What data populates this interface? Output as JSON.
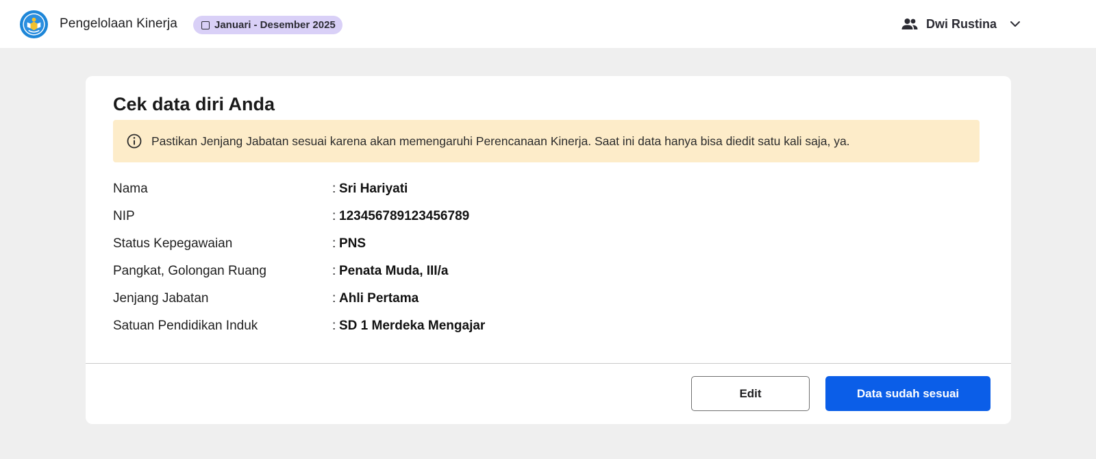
{
  "header": {
    "app_title": "Pengelolaan Kinerja",
    "period_badge": "Januari - Desember 2025",
    "user_name": "Dwi Rustina",
    "icons": {
      "logo": "tut-wuri-handayani-logo",
      "user": "users-icon",
      "dropdown": "chevron-down-icon",
      "calendar": "calendar-icon"
    }
  },
  "card": {
    "title": "Cek data diri Anda",
    "alert": {
      "icon": "info-icon",
      "text": "Pastikan Jenjang Jabatan sesuai karena akan memengaruhi Perencanaan Kinerja. Saat ini data hanya bisa diedit satu kali saja, ya."
    },
    "fields": [
      {
        "label": "Nama",
        "value": "Sri Hariyati"
      },
      {
        "label": "NIP",
        "value": "123456789123456789"
      },
      {
        "label": "Status Kepegawaian",
        "value": "PNS"
      },
      {
        "label": "Pangkat, Golongan Ruang",
        "value": "Penata Muda, III/a"
      },
      {
        "label": "Jenjang Jabatan",
        "value": "Ahli Pertama"
      },
      {
        "label": "Satuan Pendidikan Induk",
        "value": "SD 1 Merdeka Mengajar"
      }
    ],
    "separator": ":",
    "buttons": {
      "edit": "Edit",
      "confirm": "Data sudah sesuai"
    }
  },
  "colors": {
    "primary": "#0b5ee8",
    "badge_bg": "#d9d0f7",
    "alert_bg": "#fdecc9",
    "page_bg": "#efefef"
  }
}
